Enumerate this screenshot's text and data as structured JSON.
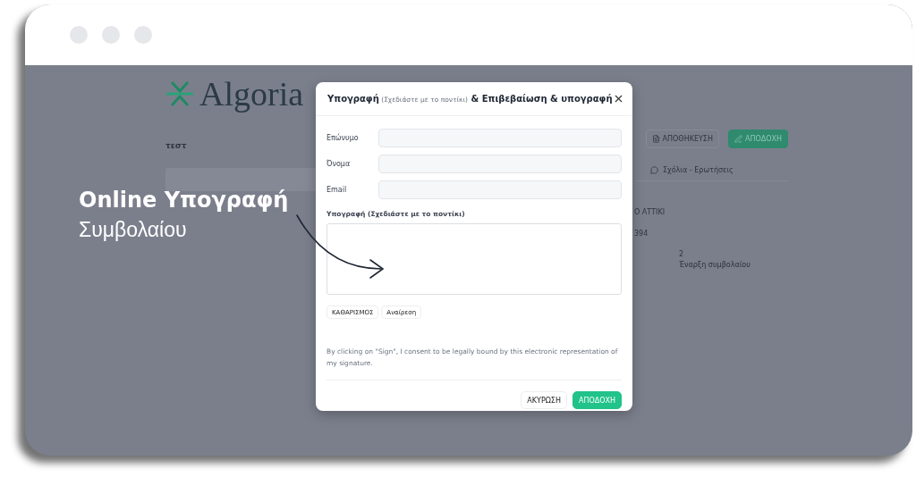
{
  "app": {
    "logo": "Algoria",
    "title": "τεστ",
    "buttons": [
      {
        "label": "ΑΠΟΘΗΚΕΥΣΗ",
        "kind": "outline"
      },
      {
        "label": "ΑΠΟΔΟΧΗ",
        "kind": "primary"
      }
    ],
    "tabs": [
      {
        "label": "Σχόλια - Ερωτήσεις",
        "selected": false
      }
    ],
    "details": [
      "Ο ΑΤΤΙΚΙ",
      "394"
    ],
    "stat": {
      "value": "2",
      "label": "Έναρξη συμβολαίου"
    }
  },
  "promo": {
    "title": "Online Υπογραφή",
    "subtitle": "Συμβολαίου"
  },
  "dialog": {
    "title": [
      {
        "text": "Υπογραφή",
        "kind": "strong"
      },
      {
        "text": "(Σχεδιάστε με το ποντίκι)",
        "kind": "note"
      },
      {
        "text": "& Επιβεβαίωση & υπογραφή",
        "kind": "strong"
      }
    ],
    "fields": [
      {
        "label": "Επώνυμο"
      },
      {
        "label": "Όνομα"
      },
      {
        "label": "Email"
      }
    ],
    "signature_label": "Υπογραφή (Σχεδιάστε με το ποντίκι)",
    "pad_buttons": [
      "ΚΑΘΑΡΙΣΜΟΣ",
      "Αναίρεση"
    ],
    "consent": "By clicking on \"Sign\", I consent to be legally bound by this electronic representation of my signature.",
    "footer_buttons": [
      {
        "label": "ΑΚΥΡΩΣΗ",
        "kind": "secondary"
      },
      {
        "label": "ΑΠΟΔΟΧΗ",
        "kind": "primary"
      }
    ]
  }
}
